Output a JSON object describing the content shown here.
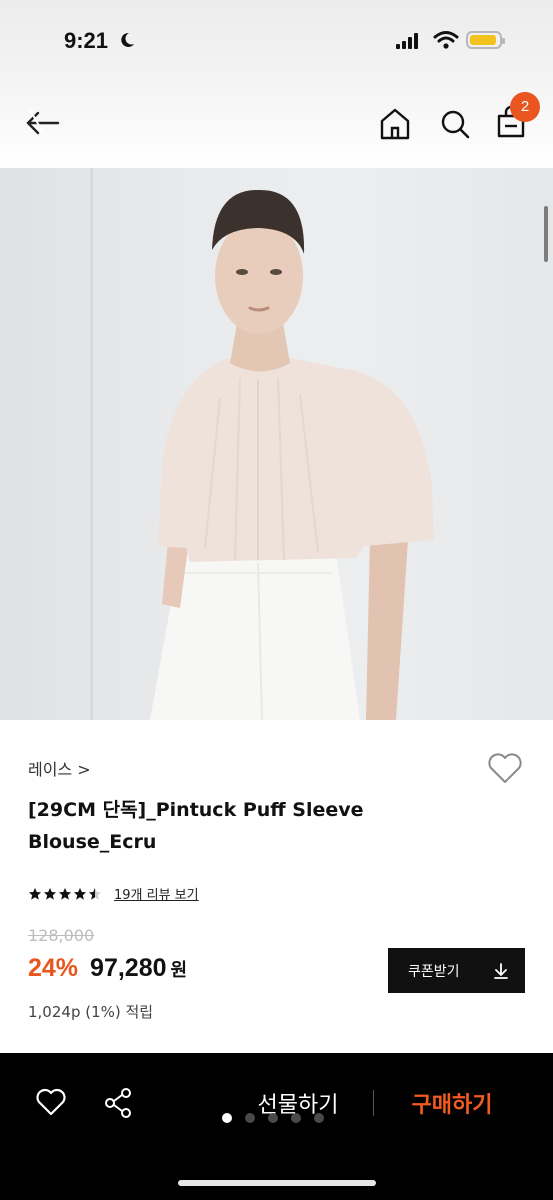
{
  "status_bar": {
    "time": "9:21"
  },
  "header": {
    "cart_count": "2",
    "icons": [
      "back-arrow-icon",
      "home-icon",
      "search-icon",
      "shopping-bag-icon"
    ]
  },
  "product": {
    "brand": "레이스 >",
    "title": "[29CM 단독]_Pintuck Puff Sleeve Blouse_Ecru",
    "rating": 4.5,
    "review_link": "19개 리뷰 보기",
    "original_price": "128,000",
    "discount": "24%",
    "price": "97,280",
    "currency": "원",
    "coupon_label": "쿠폰받기",
    "points": "1,024p (1%) 적립"
  },
  "bottom_bar": {
    "gift_label": "선물하기",
    "buy_label": "구매하기",
    "page_dots": 5,
    "active_dot": 0
  },
  "colors": {
    "accent": "#e8551f",
    "buy_text": "#f25a20",
    "coupon_bg": "#111111",
    "bottom_bar_bg": "#000000"
  }
}
